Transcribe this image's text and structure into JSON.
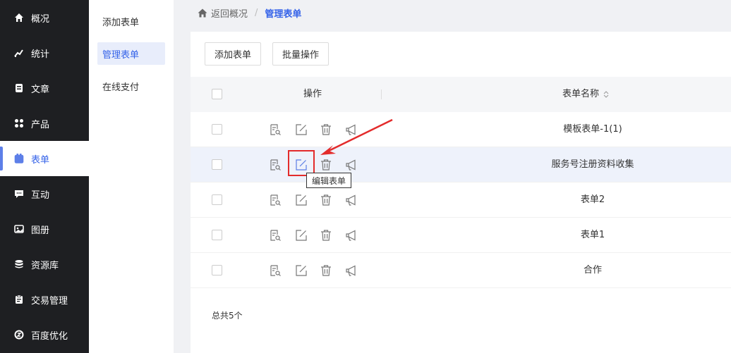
{
  "sidebar": {
    "items": [
      {
        "label": "概况",
        "icon": "home-icon"
      },
      {
        "label": "统计",
        "icon": "chart-icon"
      },
      {
        "label": "文章",
        "icon": "article-icon"
      },
      {
        "label": "产品",
        "icon": "product-icon"
      },
      {
        "label": "表单",
        "icon": "form-icon",
        "active": true
      },
      {
        "label": "互动",
        "icon": "chat-icon"
      },
      {
        "label": "图册",
        "icon": "album-icon"
      },
      {
        "label": "资源库",
        "icon": "database-icon"
      },
      {
        "label": "交易管理",
        "icon": "order-icon"
      },
      {
        "label": "百度优化",
        "icon": "seo-icon"
      }
    ]
  },
  "subnav": {
    "items": [
      {
        "label": "添加表单"
      },
      {
        "label": "管理表单",
        "active": true
      },
      {
        "label": "在线支付"
      }
    ]
  },
  "breadcrumb": {
    "back_label": "返回概况",
    "separator": "/",
    "current": "管理表单"
  },
  "toolbar": {
    "add_label": "添加表单",
    "batch_label": "批量操作"
  },
  "table": {
    "headers": {
      "ops": "操作",
      "name": "表单名称"
    },
    "rows": [
      {
        "name": "模板表单-1(1)"
      },
      {
        "name": "服务号注册资料收集",
        "highlighted": true
      },
      {
        "name": "表单2"
      },
      {
        "name": "表单1"
      },
      {
        "name": "合作"
      }
    ],
    "row_actions": [
      "preview-icon",
      "edit-icon",
      "delete-icon",
      "promote-icon"
    ]
  },
  "tooltip": {
    "text": "编辑表单"
  },
  "footer": {
    "total": "总共5个"
  },
  "colors": {
    "accent": "#3563e9",
    "sidebar_bg": "#1e1f22",
    "annotation": "#e32b2b"
  }
}
